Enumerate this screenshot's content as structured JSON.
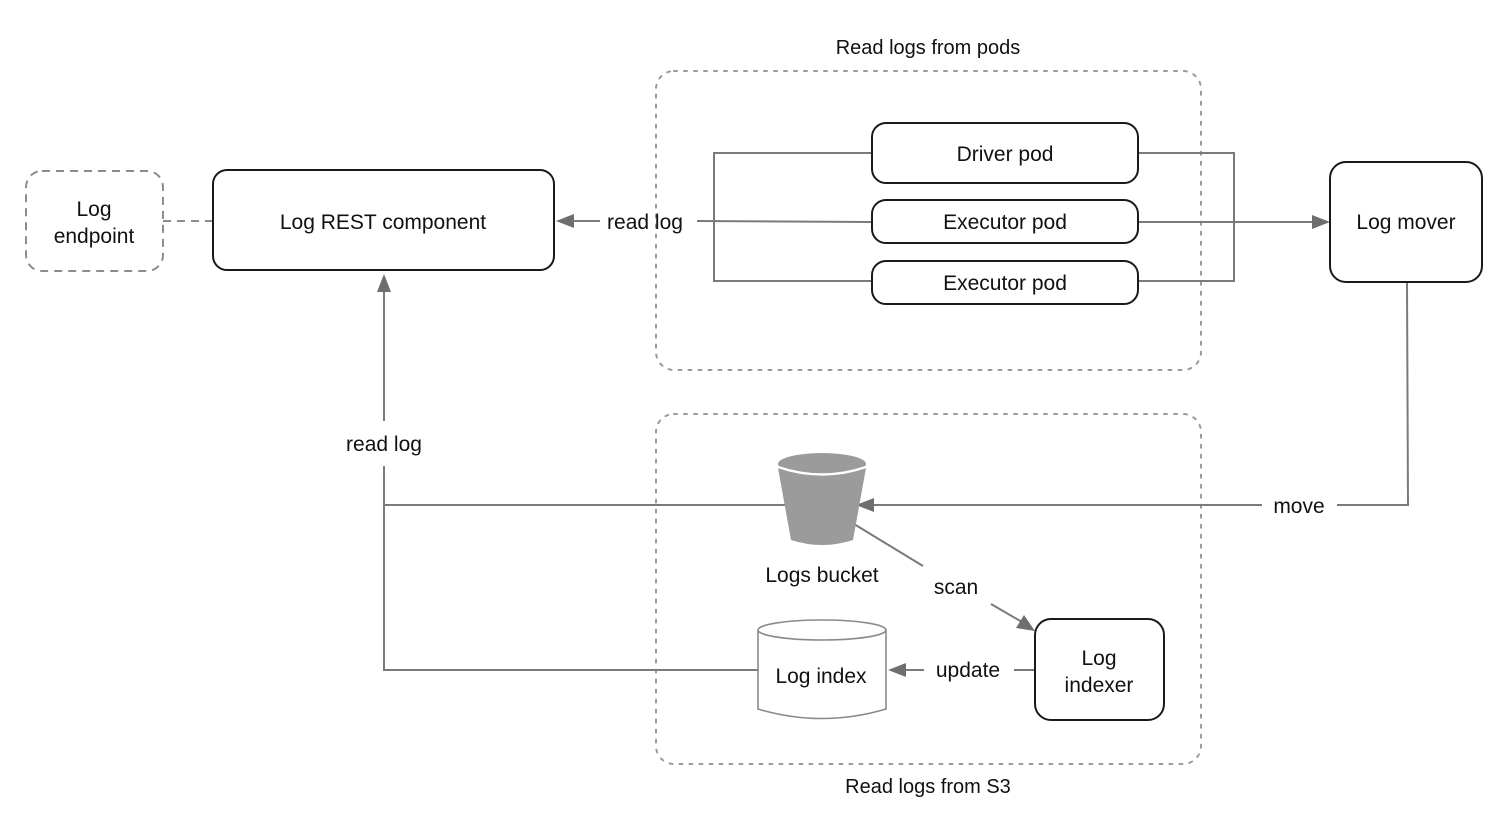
{
  "groups": {
    "pods": {
      "title": "Read logs from pods"
    },
    "s3": {
      "title": "Read logs from S3"
    }
  },
  "nodes": {
    "log_endpoint": {
      "line1": "Log",
      "line2": "endpoint"
    },
    "log_rest": {
      "label": "Log REST component"
    },
    "driver_pod": {
      "label": "Driver pod"
    },
    "executor_pod_1": {
      "label": "Executor pod"
    },
    "executor_pod_2": {
      "label": "Executor pod"
    },
    "log_mover": {
      "label": "Log mover"
    },
    "logs_bucket": {
      "label": "Logs bucket",
      "icon": "bucket-icon"
    },
    "log_index": {
      "label": "Log index",
      "icon": "database-cylinder-icon"
    },
    "log_indexer": {
      "line1": "Log",
      "line2": "indexer"
    }
  },
  "edges": {
    "pods_to_rest": {
      "label": "read log"
    },
    "s3_to_rest": {
      "label": "read log"
    },
    "mover_to_bucket": {
      "label": "move"
    },
    "bucket_to_indexer": {
      "label": "scan"
    },
    "indexer_to_index": {
      "label": "update"
    }
  },
  "colors": {
    "node_stroke": "#1a1a1a",
    "edge": "#7a7a7a",
    "arrowhead": "#6e6e6e",
    "group_border": "#9a9a9a",
    "bucket_fill": "#9b9b9b",
    "text": "#111111"
  }
}
